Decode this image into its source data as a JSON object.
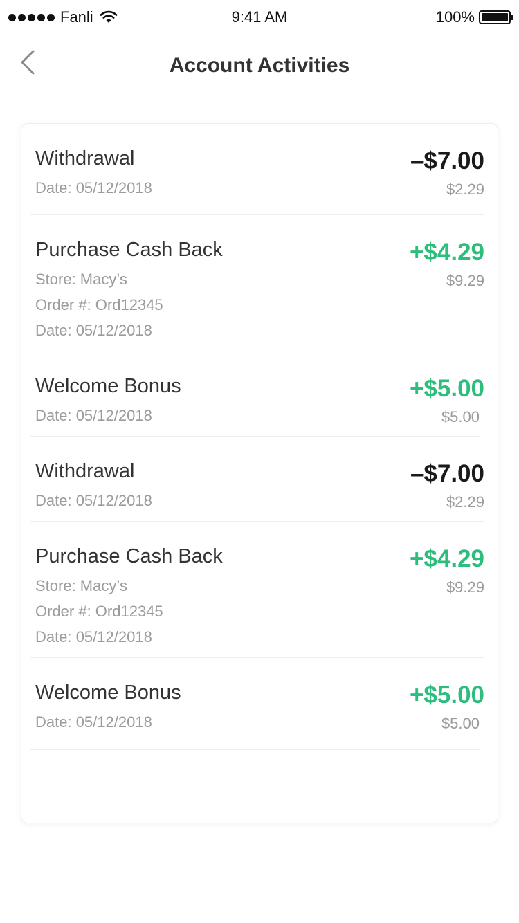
{
  "status_bar": {
    "carrier": "Fanli",
    "time": "9:41 AM",
    "battery": "100%",
    "signal_icon": "signal-dots-icon",
    "wifi_icon": "wifi-icon",
    "battery_icon": "battery-icon"
  },
  "nav": {
    "title": "Account Activities",
    "back_icon": "chevron-left-icon"
  },
  "colors": {
    "positive": "#2dbe7e",
    "negative": "#1a1a1a",
    "secondary_text": "#9b9b9b",
    "primary_text": "#333333"
  },
  "activities": [
    {
      "title": "Withdrawal",
      "details": [
        "Date: 05/12/2018"
      ],
      "amount": "–$7.00",
      "balance": "$2.29",
      "type": "negative"
    },
    {
      "title": "Purchase Cash Back",
      "details": [
        "Store: Macy’s",
        "Order #: Ord12345",
        "Date: 05/12/2018"
      ],
      "amount": "+$4.29",
      "balance": "$9.29",
      "type": "positive"
    },
    {
      "title": "Welcome Bonus",
      "details": [
        "Date: 05/12/2018"
      ],
      "amount": "+$5.00",
      "balance": "$5.00",
      "type": "positive"
    },
    {
      "title": "Withdrawal",
      "details": [
        "Date: 05/12/2018"
      ],
      "amount": "–$7.00",
      "balance": "$2.29",
      "type": "negative"
    },
    {
      "title": "Purchase Cash Back",
      "details": [
        "Store: Macy’s",
        "Order #: Ord12345",
        "Date: 05/12/2018"
      ],
      "amount": "+$4.29",
      "balance": "$9.29",
      "type": "positive"
    },
    {
      "title": "Welcome Bonus",
      "details": [
        "Date: 05/12/2018"
      ],
      "amount": "+$5.00",
      "balance": "$5.00",
      "type": "positive"
    }
  ]
}
